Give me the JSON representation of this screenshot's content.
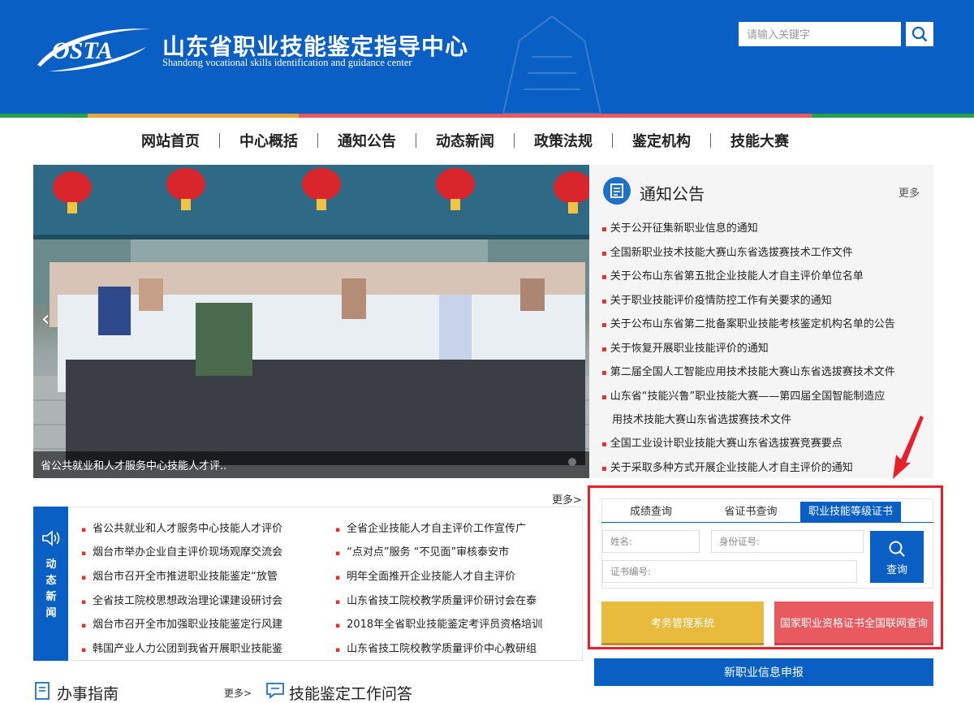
{
  "header": {
    "logo_text": "OSTA",
    "title": "山东省职业技能鉴定指导中心",
    "subtitle": "Shandong vocational skills identification and guidance center",
    "search_placeholder": "请输入关键字",
    "colors": {
      "header_bg": "#0a5fc4",
      "accent_red": "#e8202b"
    }
  },
  "color_bar": [
    "#2a9f4a",
    "#e6a43b",
    "#e85a60",
    "#2a9f4a"
  ],
  "nav": [
    {
      "label": "网站首页"
    },
    {
      "label": "中心概括"
    },
    {
      "label": "通知公告"
    },
    {
      "label": "动态新闻"
    },
    {
      "label": "政策法规"
    },
    {
      "label": "鉴定机构"
    },
    {
      "label": "技能大赛"
    }
  ],
  "banner": {
    "caption": "省公共就业和人才服务中心技能人才评.."
  },
  "notices": {
    "title": "通知公告",
    "more": "更多",
    "items": [
      "关于公开征集新职业信息的通知",
      "全国新职业技术技能大赛山东省选拔赛技术工作文件",
      "关于公布山东省第五批企业技能人才自主评价单位名单",
      "关于职业技能评价疫情防控工作有关要求的通知",
      "关于公布山东省第二批备案职业技能考核鉴定机构名单的公告",
      "关于恢复开展职业技能评价的通知",
      "第二届全国人工智能应用技术技能大赛山东省选拔赛技术文件",
      "山东省“技能兴鲁”职业技能大赛——第四届全国智能制造应",
      "用技术技能大赛山东省选拔赛技术文件",
      "全国工业设计职业技能大赛山东省选拔赛竞赛要点",
      "关于采取多种方式开展企业技能人才自主评价的通知"
    ]
  },
  "news": {
    "side_label": [
      "动",
      "态",
      "新",
      "闻"
    ],
    "more": "更多>",
    "left": [
      "省公共就业和人才服务中心技能人才评价",
      "烟台市举办企业自主评价现场观摩交流会",
      "烟台市召开全市推进职业技能鉴定“放管",
      "全省技工院校思想政治理论课建设研讨会",
      "烟台市召开全市加强职业技能鉴定行风建",
      "韩国产业人力公团到我省开展职业技能鉴"
    ],
    "right": [
      "全省企业技能人才自主评价工作宣传广",
      "“点对点”服务 “不见面”审核泰安市",
      "明年全面推开企业技能人才自主评价",
      "山东省技工院校教学质量评价研讨会在泰",
      "2018年全省职业技能鉴定考评员资格培训",
      "山东省技工院校教学质量评价中心教研组"
    ]
  },
  "query": {
    "tabs": [
      "成绩查询",
      "省证书查询",
      "职业技能等级证书"
    ],
    "active_tab": "职业技能等级证书",
    "name_label": "姓名:",
    "id_label": "身份证号:",
    "cert_label": "证书编号:",
    "query_button": "查询",
    "exam_system": "考务管理系统",
    "national_query": "国家职业资格证书全国联网查询",
    "new_job": "新职业信息申报"
  },
  "bottom": {
    "guide_title": "办事指南",
    "guide_more": "更多>",
    "qa_title": "技能鉴定工作问答"
  }
}
